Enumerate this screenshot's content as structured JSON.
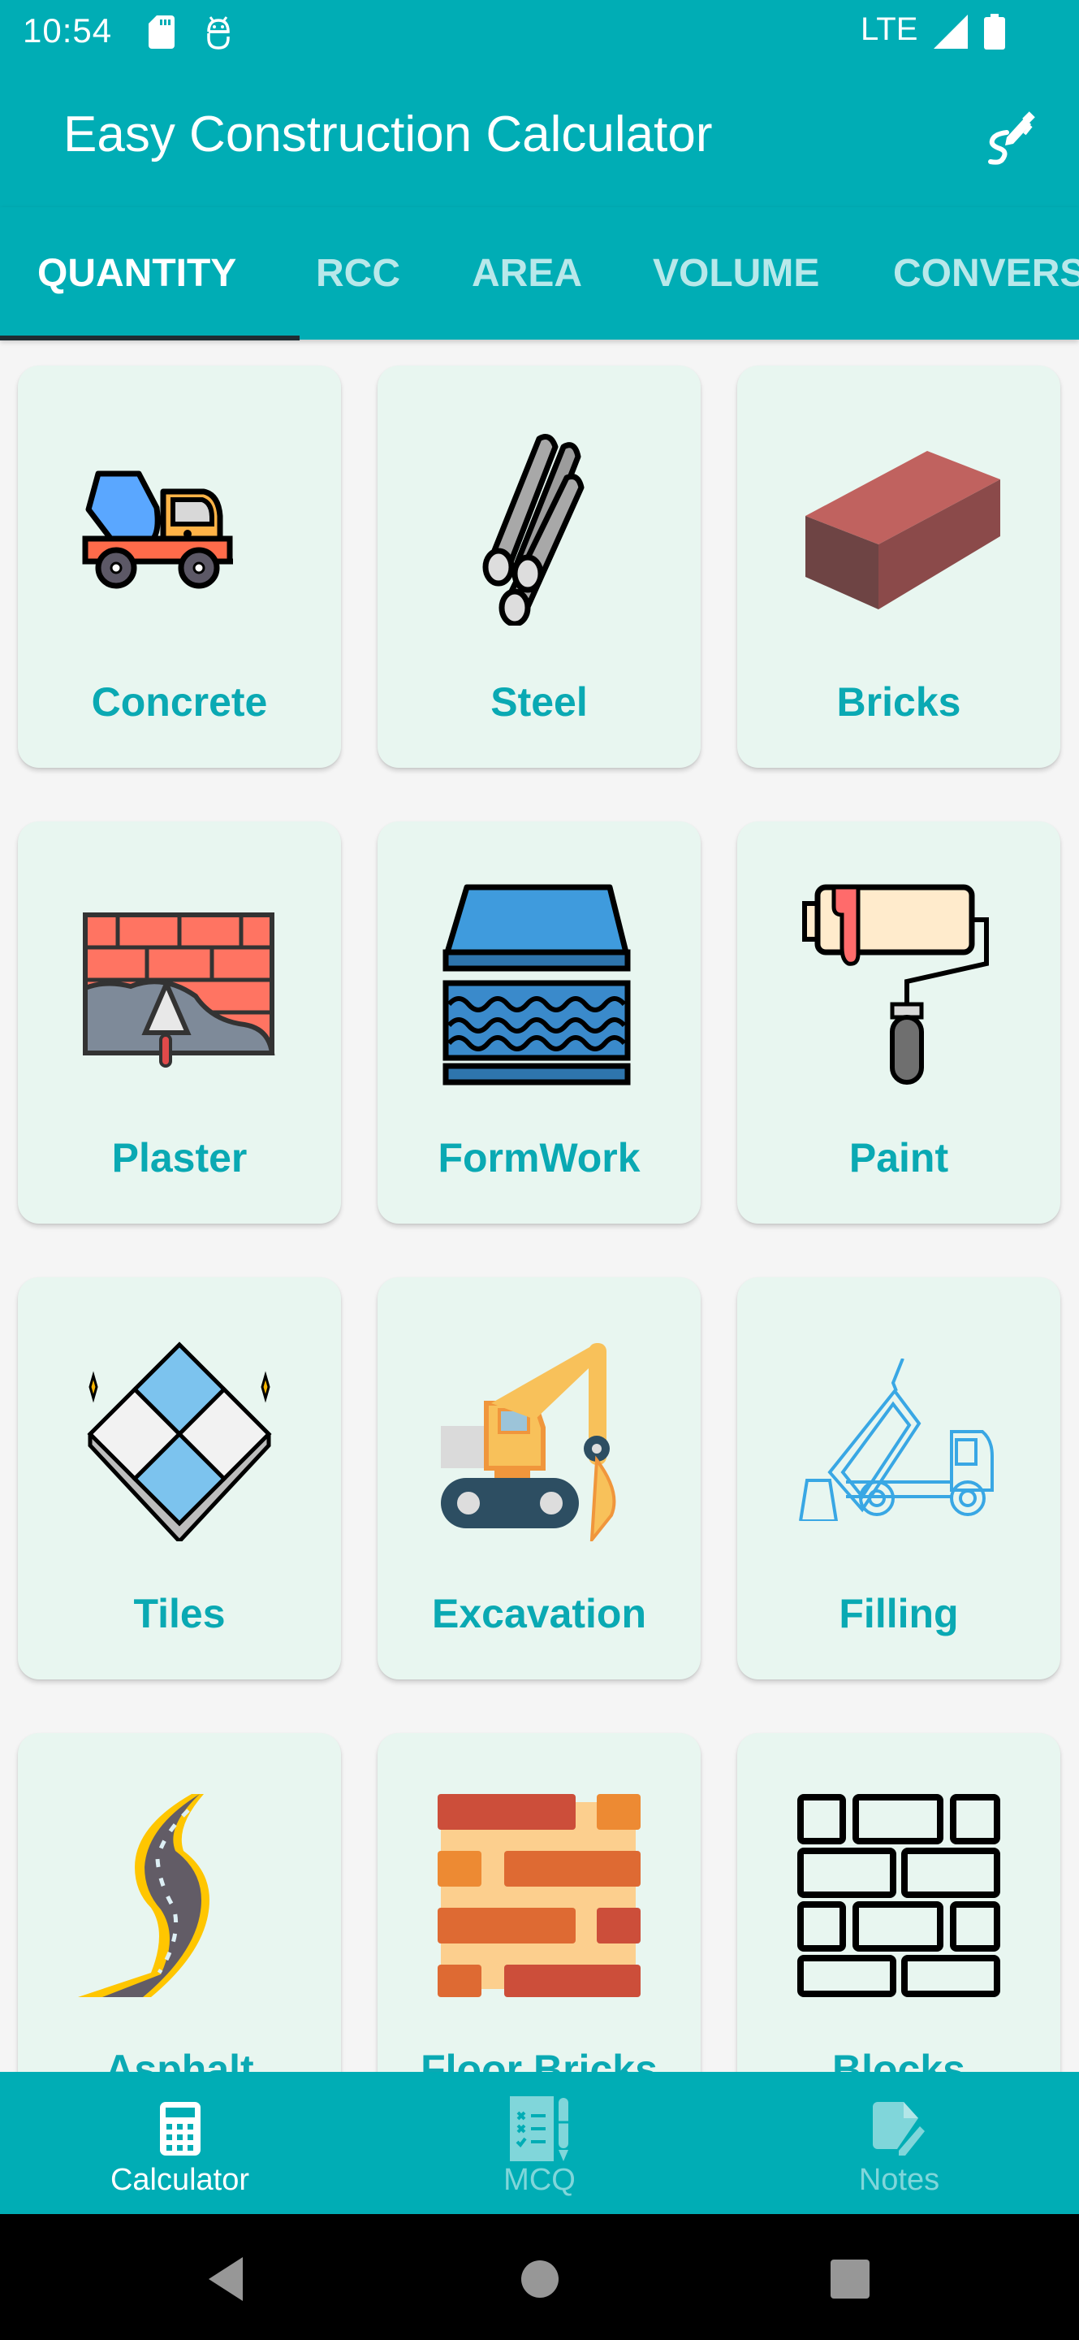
{
  "status_bar": {
    "time": "10:54",
    "network": "LTE",
    "icons": [
      "sd-card-icon",
      "android-debug-icon",
      "signal-icon",
      "battery-icon"
    ]
  },
  "app_bar": {
    "title": "Easy Construction Calculator",
    "action_icon": "signature-pen-icon"
  },
  "tabs": [
    {
      "label": "QUANTITY",
      "active": true
    },
    {
      "label": "RCC",
      "active": false
    },
    {
      "label": "AREA",
      "active": false
    },
    {
      "label": "VOLUME",
      "active": false
    },
    {
      "label": "CONVERS",
      "active": false
    }
  ],
  "calculators": [
    {
      "label": "Concrete",
      "icon": "concrete-mixer-truck-icon"
    },
    {
      "label": "Steel",
      "icon": "steel-bars-icon"
    },
    {
      "label": "Bricks",
      "icon": "brick-icon"
    },
    {
      "label": "Plaster",
      "icon": "plaster-trowel-wall-icon"
    },
    {
      "label": "FormWork",
      "icon": "formwork-icon"
    },
    {
      "label": "Paint",
      "icon": "paint-roller-icon"
    },
    {
      "label": "Tiles",
      "icon": "tiles-icon"
    },
    {
      "label": "Excavation",
      "icon": "excavator-icon"
    },
    {
      "label": "Filling",
      "icon": "dump-truck-icon"
    },
    {
      "label": "Asphalt",
      "icon": "asphalt-road-icon"
    },
    {
      "label": "Floor Bricks",
      "icon": "floor-bricks-icon"
    },
    {
      "label": "Blocks",
      "icon": "blocks-icon"
    }
  ],
  "bottom_nav": [
    {
      "label": "Calculator",
      "icon": "calculator-icon",
      "active": true
    },
    {
      "label": "MCQ",
      "icon": "mcq-checklist-icon",
      "active": false
    },
    {
      "label": "Notes",
      "icon": "notes-edit-icon",
      "active": false
    }
  ],
  "colors": {
    "primary": "#00ADB5",
    "tab_indicator": "#1F2D33",
    "card_background": "#E8F6F0",
    "card_label": "#0AA9B3",
    "page_background": "#F5F5F5"
  }
}
